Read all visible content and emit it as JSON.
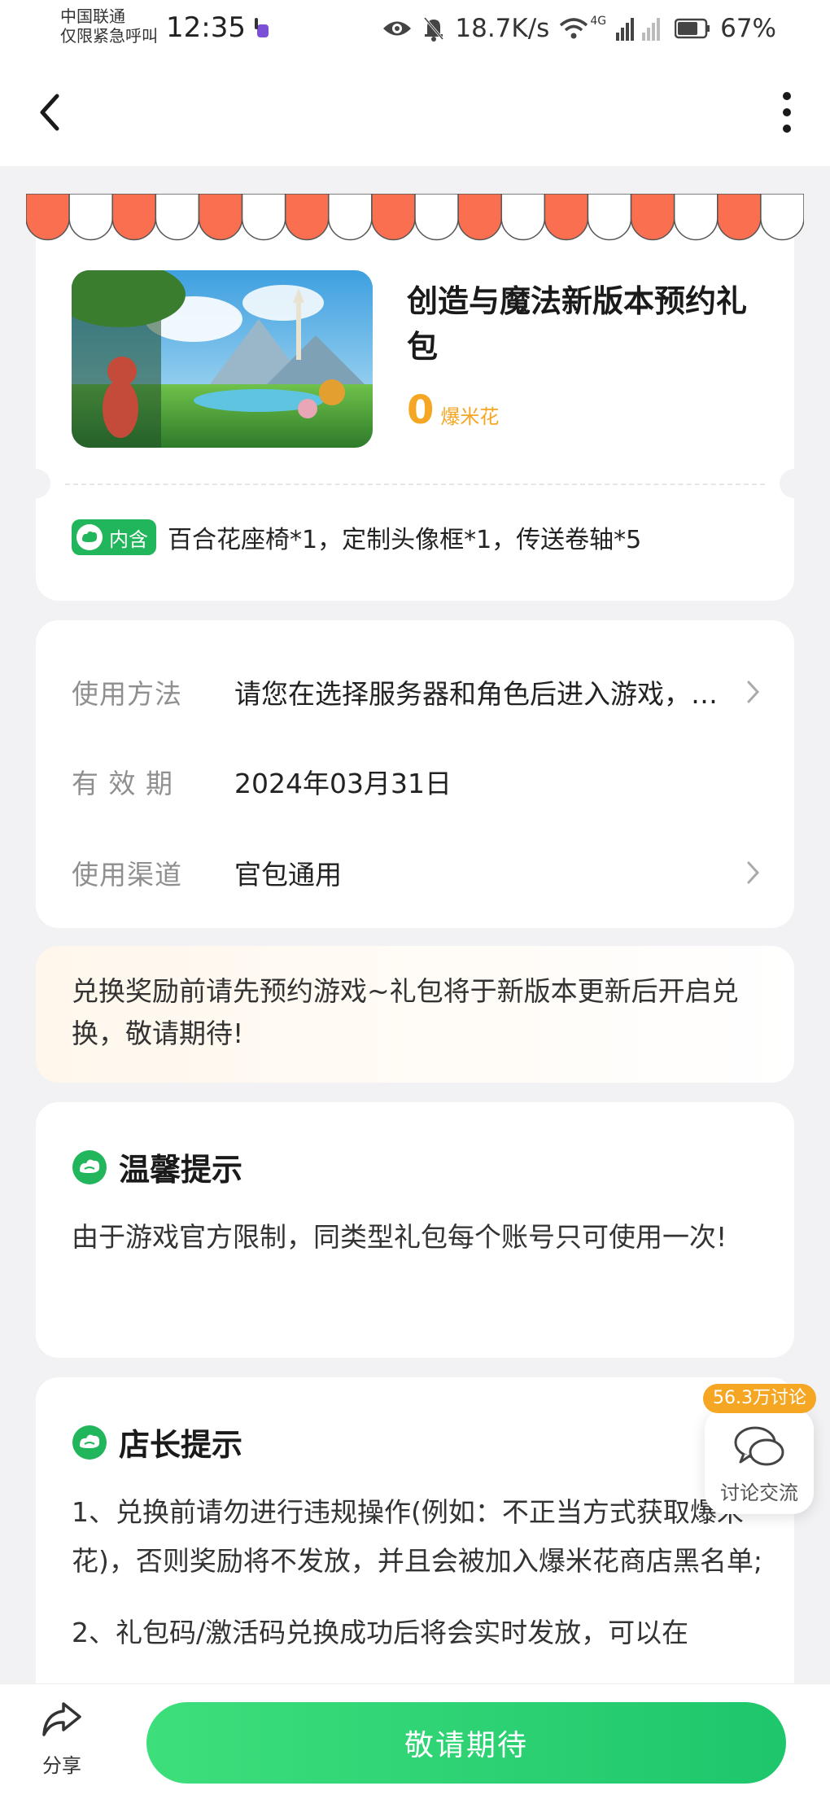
{
  "status_bar": {
    "carrier_line1": "中国联通",
    "carrier_line2": "仅限紧急呼叫",
    "time": "12:35",
    "net_speed": "18.7K/s",
    "network_type": "4G",
    "battery": "67%",
    "icons": [
      "eye-icon",
      "mute-bell-icon",
      "wifi-icon",
      "signal-icon",
      "battery-icon"
    ]
  },
  "nav": {
    "back_icon": "back-arrow-icon",
    "more_icon": "more-vertical-icon"
  },
  "gift": {
    "title": "创造与魔法新版本预约礼包",
    "price": "0",
    "price_unit": "爆米花",
    "includes_badge": "内含",
    "includes": "百合花座椅*1，定制头像框*1，传送卷轴*5"
  },
  "info": {
    "rows": [
      {
        "label": "使用方法",
        "value": "请您在选择服务器和角色后进入游戏，在设置中输入兑换码领取"
      },
      {
        "label": "有 效 期",
        "value": "2024年03月31日"
      },
      {
        "label": "使用渠道",
        "value": "官包通用"
      }
    ]
  },
  "notice": {
    "text": "兑换奖励前请先预约游戏~礼包将于新版本更新后开启兑换，敬请期待!"
  },
  "warm_tip": {
    "title": "温馨提示",
    "body": "由于游戏官方限制，同类型礼包每个账号只可使用一次!"
  },
  "shop_tip": {
    "title": "店长提示",
    "line1": "1、兑换前请勿进行违规操作(例如：不正当方式获取爆米花)，否则奖励将不发放，并且会被加入爆米花商店黑名单;",
    "line2": "2、礼包码/激活码兑换成功后将会实时发放，可以在"
  },
  "discussion": {
    "badge": "56.3万讨论",
    "label": "讨论交流"
  },
  "bottom": {
    "share_label": "分享",
    "button_label": "敬请期待"
  },
  "colors": {
    "accent_green": "#22b65c",
    "price_orange": "#f5a623",
    "awning_red": "#fa6f4f"
  }
}
